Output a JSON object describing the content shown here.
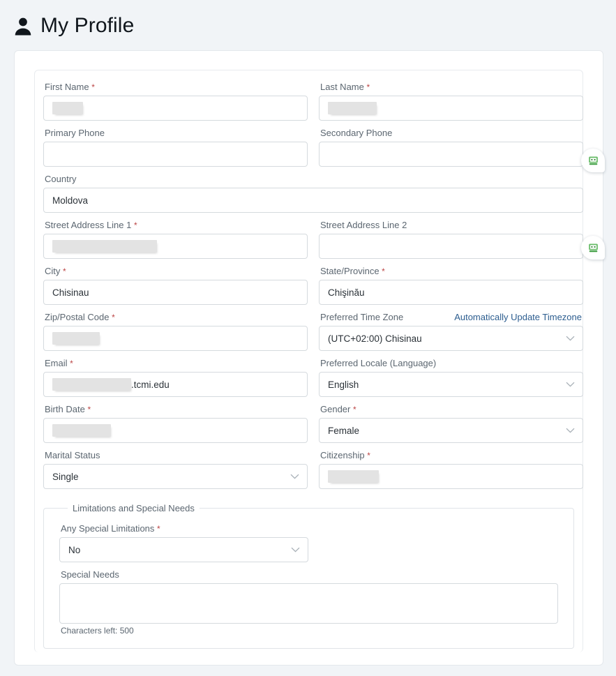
{
  "header": {
    "title": "My Profile",
    "icon": "person-icon"
  },
  "colors": {
    "page_background": "#f1f4f7",
    "card_background": "#ffffff",
    "label_text": "#5b6670",
    "value_text": "#2b3238",
    "required_marker": "#b44444",
    "link": "#2c5d8f",
    "border": "#d5dade",
    "redaction": "#e3e3e3",
    "robot_icon_green": "#4caf50"
  },
  "form": {
    "first_name": {
      "label": "First Name",
      "required": true,
      "value": "",
      "redacted": true,
      "redact_width": 44,
      "type": "text"
    },
    "last_name": {
      "label": "Last Name",
      "required": true,
      "value": "",
      "redacted": true,
      "redact_width": 70,
      "type": "text"
    },
    "primary_phone": {
      "label": "Primary Phone",
      "required": false,
      "value": "",
      "type": "text"
    },
    "secondary_phone": {
      "label": "Secondary Phone",
      "required": false,
      "value": "",
      "type": "text"
    },
    "country": {
      "label": "Country",
      "required": false,
      "value": "Moldova",
      "type": "text"
    },
    "street_address_1": {
      "label": "Street Address Line 1",
      "required": true,
      "value": "",
      "redacted": true,
      "redact_width": 150,
      "type": "text"
    },
    "street_address_2": {
      "label": "Street Address Line 2",
      "required": false,
      "value": "",
      "type": "text"
    },
    "city": {
      "label": "City",
      "required": true,
      "value": "Chisinau",
      "type": "text"
    },
    "state_province": {
      "label": "State/Province",
      "required": true,
      "value": "Chişinău",
      "type": "text"
    },
    "zip_postal_code": {
      "label": "Zip/Postal Code",
      "required": true,
      "value": "",
      "redacted": true,
      "redact_width": 68,
      "type": "text"
    },
    "preferred_time_zone": {
      "label": "Preferred Time Zone",
      "required": false,
      "value": "(UTC+02:00) Chisinau",
      "type": "select",
      "action_link": "Automatically Update Timezone"
    },
    "email": {
      "label": "Email",
      "required": true,
      "value": ".tcmi.edu",
      "redacted": true,
      "redact_width": 113,
      "type": "text"
    },
    "preferred_locale": {
      "label": "Preferred Locale (Language)",
      "required": false,
      "value": "English",
      "type": "select"
    },
    "birth_date": {
      "label": "Birth Date",
      "required": true,
      "value": "",
      "redacted": true,
      "redact_width": 84,
      "type": "text"
    },
    "gender": {
      "label": "Gender",
      "required": true,
      "value": "Female",
      "type": "select"
    },
    "marital_status": {
      "label": "Marital Status",
      "required": false,
      "value": "Single",
      "type": "select"
    },
    "citizenship": {
      "label": "Citizenship",
      "required": true,
      "value": "",
      "redacted": true,
      "redact_width": 73,
      "type": "text"
    }
  },
  "limitations_group": {
    "legend": "Limitations and Special Needs",
    "any_special_limitations": {
      "label": "Any Special Limitations",
      "required": true,
      "value": "No",
      "type": "select"
    },
    "special_needs": {
      "label": "Special Needs",
      "required": false,
      "value": "",
      "type": "textarea",
      "counter": "Characters left:  500"
    }
  },
  "autofill_badges": [
    {
      "name": "robot-autofill-badge-last-name",
      "icon": "robot-icon"
    },
    {
      "name": "robot-autofill-badge-country",
      "icon": "robot-icon"
    }
  ]
}
